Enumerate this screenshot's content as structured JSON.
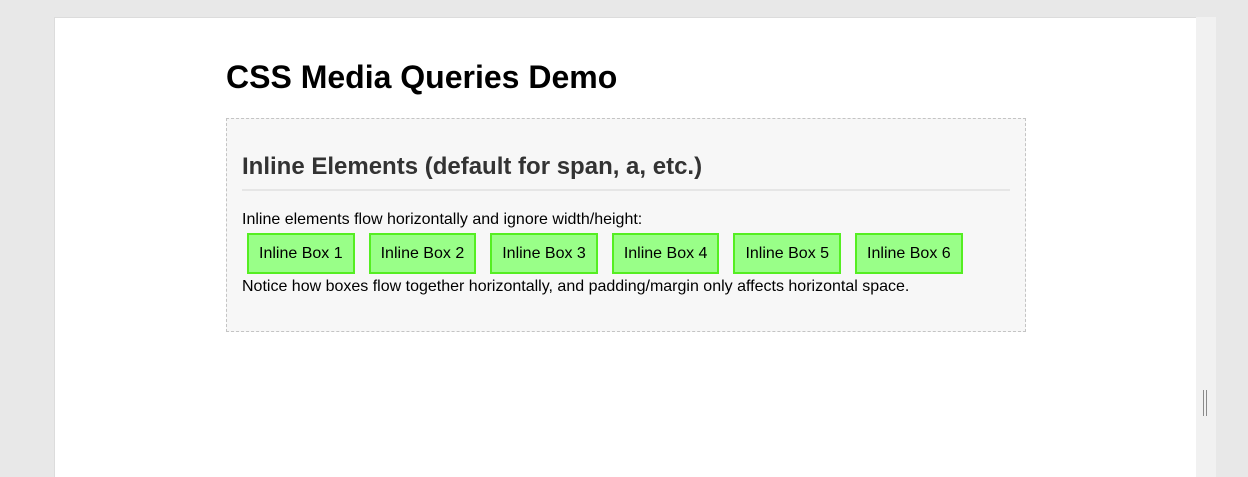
{
  "page": {
    "title": "CSS Media Queries Demo"
  },
  "section": {
    "heading": "Inline Elements (default for span, a, etc.)",
    "intro": "Inline elements flow horizontally and ignore width/height:",
    "boxes": [
      {
        "label": "Inline Box 1"
      },
      {
        "label": "Inline Box 2"
      },
      {
        "label": "Inline Box 3"
      },
      {
        "label": "Inline Box 4"
      },
      {
        "label": "Inline Box 5"
      },
      {
        "label": "Inline Box 6"
      }
    ],
    "notice": "Notice how boxes flow together horizontally, and padding/margin only affects horizontal space."
  },
  "colors": {
    "box_fill": "#99ff88",
    "box_border": "#55ee22",
    "section_background": "#f7f7f7"
  }
}
